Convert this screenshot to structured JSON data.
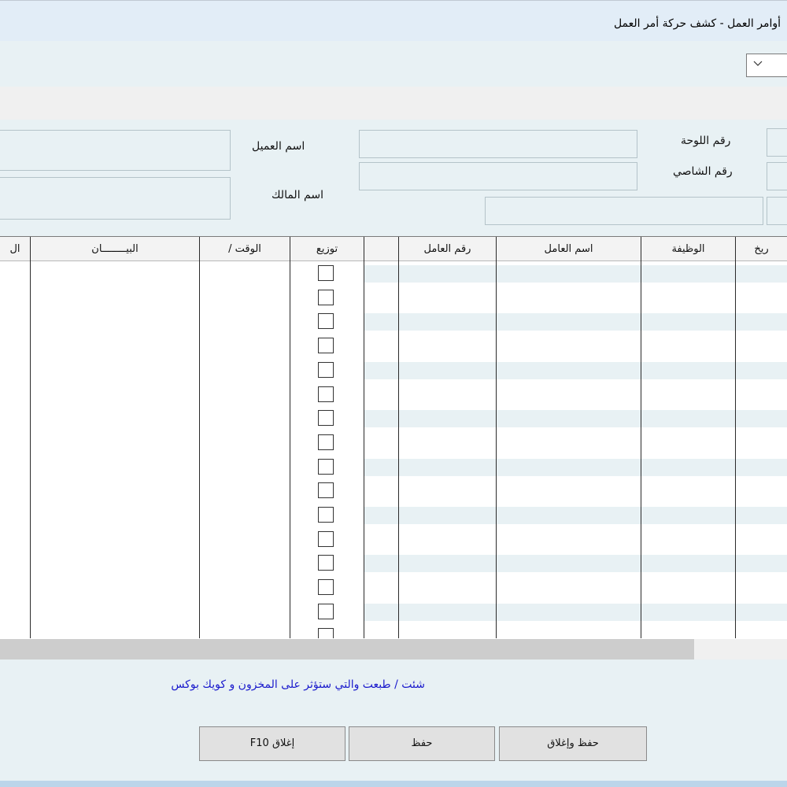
{
  "window": {
    "title": "أوامر العمل - كشف حركة أمر العمل"
  },
  "toolbar": {
    "dropdown": {
      "selected": "",
      "icon": "chevron-down-icon"
    }
  },
  "form": {
    "customer_name_label": "اسم العميل",
    "owner_name_label": "اسم المالك",
    "plate_number_label": "رقم اللوحة",
    "chassis_number_label": "رقم الشاصي",
    "customer_name_value": "",
    "owner_name_value": "",
    "plate_number_value": "",
    "chassis_number_value": ""
  },
  "grid": {
    "columns": [
      "ال",
      "البيــــــــان",
      "الوقت /",
      "توزيع",
      "",
      "رقم العامل",
      "اسم العامل",
      "الوظيفة",
      "ريخ"
    ],
    "rows": 16
  },
  "footer": {
    "note": "شئت / طبعت والتي ستؤثر على المخزون و كويك بوكس",
    "note_color": "#1a1acc",
    "buttons": {
      "save_close": "حفظ وإغلاق",
      "save": "حفظ",
      "close": "إغلاق F10"
    }
  }
}
